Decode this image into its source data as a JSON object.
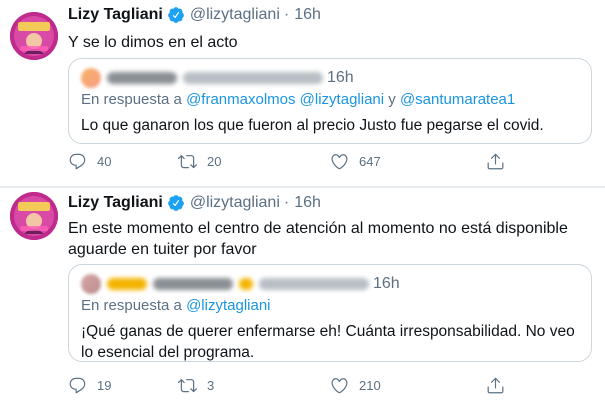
{
  "tweets": [
    {
      "author_name": "Lizy Tagliani",
      "handle": "@lizytagliani",
      "dot": "·",
      "time": "16h",
      "text": "Y se lo dimos en el acto",
      "quote": {
        "time": "16h",
        "reply_prefix": "En respuesta a",
        "reply_to": "@franmaxolmos @lizytagliani",
        "reply_and": "y",
        "reply_to_2": "@santumaratea1",
        "text": "Lo que ganaron los que fueron al precio Justo fue pegarse el covid."
      },
      "stats": {
        "replies": "40",
        "retweets": "20",
        "likes": "647"
      }
    },
    {
      "author_name": "Lizy Tagliani",
      "handle": "@lizytagliani",
      "dot": "·",
      "time": "16h",
      "text": "En este momento el centro de atención al momento no está disponible aguarde en tuiter por favor",
      "quote": {
        "time": "16h",
        "reply_prefix": "En respuesta a",
        "reply_to": "@lizytagliani",
        "text": "¡Qué ganas de querer enfermarse eh! Cuánta irresponsabilidad. No veo lo esencial del programa."
      },
      "stats": {
        "replies": "19",
        "retweets": "3",
        "likes": "210"
      }
    }
  ],
  "colors": {
    "text": "#0f1419",
    "muted": "#5b7083",
    "link": "#1b95e0",
    "verified": "#1da1f2",
    "border": "#ccd6dd",
    "avatar": "#c02a8c"
  },
  "icons": [
    "verified-badge-icon",
    "reply-icon",
    "retweet-icon",
    "like-icon",
    "share-icon"
  ]
}
